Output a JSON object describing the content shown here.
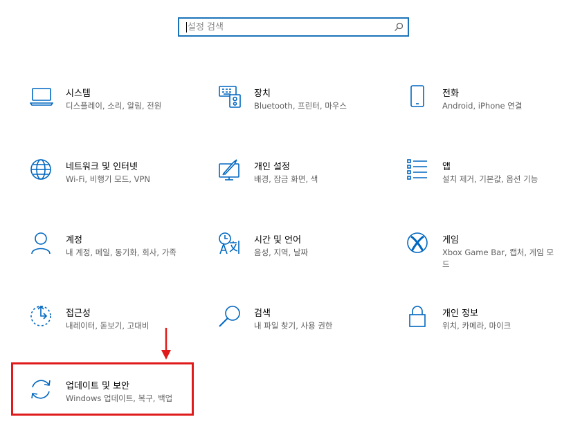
{
  "search": {
    "placeholder": "설정 검색",
    "icon": "search-icon"
  },
  "tiles": [
    {
      "title": "시스템",
      "desc": "디스플레이, 소리, 알림, 전원",
      "icon": "laptop-icon"
    },
    {
      "title": "장치",
      "desc": "Bluetooth, 프린터, 마우스",
      "icon": "devices-icon"
    },
    {
      "title": "전화",
      "desc": "Android, iPhone 연결",
      "icon": "phone-icon"
    },
    {
      "title": "네트워크 및 인터넷",
      "desc": "Wi-Fi, 비행기 모드, VPN",
      "icon": "globe-icon"
    },
    {
      "title": "개인 설정",
      "desc": "배경, 잠금 화면, 색",
      "icon": "personalization-icon"
    },
    {
      "title": "앱",
      "desc": "설치 제거, 기본값, 옵션 기능",
      "icon": "apps-list-icon"
    },
    {
      "title": "계정",
      "desc": "내 계정, 메일, 동기화, 회사, 가족",
      "icon": "person-icon"
    },
    {
      "title": "시간 및 언어",
      "desc": "음성, 지역, 날짜",
      "icon": "time-language-icon"
    },
    {
      "title": "게임",
      "desc": "Xbox Game Bar, 캡처, 게임 모드",
      "icon": "xbox-icon"
    },
    {
      "title": "접근성",
      "desc": "내레이터, 돋보기, 고대비",
      "icon": "accessibility-icon"
    },
    {
      "title": "검색",
      "desc": "내 파일 찾기, 사용 권한",
      "icon": "search-icon"
    },
    {
      "title": "개인 정보",
      "desc": "위치, 카메라, 마이크",
      "icon": "lock-icon"
    },
    {
      "title": "업데이트 및 보안",
      "desc": "Windows 업데이트, 복구, 백업",
      "icon": "sync-icon"
    }
  ],
  "colors": {
    "accent": "#0067c0",
    "highlight": "#e01a1a",
    "desc_text": "#5f5f5f"
  }
}
